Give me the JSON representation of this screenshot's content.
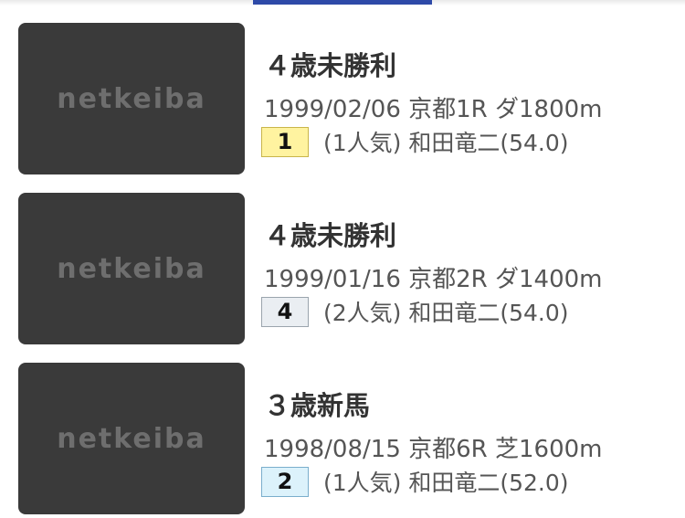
{
  "races": [
    {
      "thumbnail_logo": "netkeiba",
      "title": "４歳未勝利",
      "meta": "1999/02/06 京都1R ダ1800m",
      "rank": "1",
      "detail": "(1人気) 和田竜二(54.0)"
    },
    {
      "thumbnail_logo": "netkeiba",
      "title": "４歳未勝利",
      "meta": "1999/01/16 京都2R ダ1400m",
      "rank": "4",
      "detail": "(2人気) 和田竜二(54.0)"
    },
    {
      "thumbnail_logo": "netkeiba",
      "title": "３歳新馬",
      "meta": "1998/08/15 京都6R 芝1600m",
      "rank": "2",
      "detail": "(1人気) 和田竜二(52.0)"
    }
  ],
  "colors": {
    "tab_indicator": "#2e4aa8",
    "thumbnail_bg": "#3a3a3a",
    "rank_1_bg": "#fff3a0",
    "rank_2_bg": "#dcf2fb",
    "rank_other_bg": "#eaeef2"
  }
}
